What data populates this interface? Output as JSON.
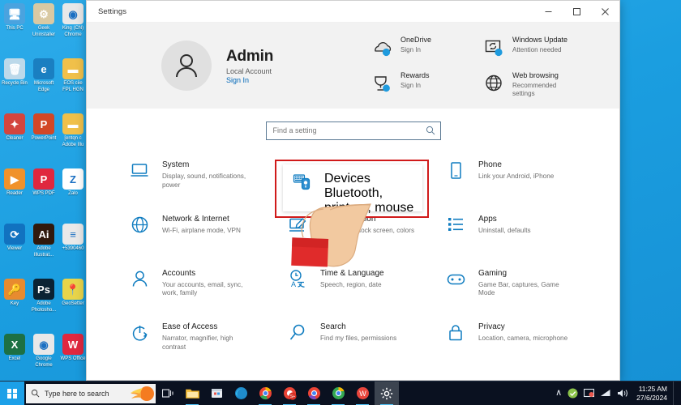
{
  "desktop": {
    "icons": [
      {
        "label": "This PC",
        "icon": "computer-icon",
        "color": "#4aa3df",
        "glyph": "🖥"
      },
      {
        "label": "Geek Uninstaller",
        "icon": "geek-uninstaller-icon",
        "color": "#d9c9a3",
        "glyph": "⚙"
      },
      {
        "label": "King (CN) Chrome",
        "icon": "chrome-king-icon",
        "color": "#e8e8e8",
        "glyph": "◉"
      },
      {
        "label": "Recycle Bin",
        "icon": "recycle-bin-icon",
        "color": "#bcd9ea",
        "glyph": "🗑"
      },
      {
        "label": "Microsoft Edge",
        "icon": "edge-icon",
        "color": "#1a7fc1",
        "glyph": "e"
      },
      {
        "label": "EOS ciie FPL HGN",
        "icon": "folder-icon",
        "color": "#f0c04a",
        "glyph": "▬"
      },
      {
        "label": "Cleaner",
        "icon": "ccleaner-icon",
        "color": "#d3453e",
        "glyph": "✦"
      },
      {
        "label": "PowerPoint",
        "icon": "powerpoint-icon",
        "color": "#d24726",
        "glyph": "P"
      },
      {
        "label": "[entqn c Adobe Illu",
        "icon": "folder-icon",
        "color": "#f0c04a",
        "glyph": "▬"
      },
      {
        "label": "Reader",
        "icon": "foxit-reader-icon",
        "color": "#f0922b",
        "glyph": "▶"
      },
      {
        "label": "WPS PDF",
        "icon": "wps-pdf-icon",
        "color": "#e0273f",
        "glyph": "P"
      },
      {
        "label": "Zalo",
        "icon": "zalo-icon",
        "color": "#ffffff",
        "glyph": "Z"
      },
      {
        "label": "Viewer",
        "icon": "teamviewer-icon",
        "color": "#1172c0",
        "glyph": "⟳"
      },
      {
        "label": "Adobe Illustrat...",
        "icon": "illustrator-icon",
        "color": "#31190c",
        "glyph": "Ai"
      },
      {
        "label": "+5390460",
        "icon": "document-icon",
        "color": "#e9e9e9",
        "glyph": "≡"
      },
      {
        "label": "Key",
        "icon": "key-icon",
        "color": "#e88b2f",
        "glyph": "🔑"
      },
      {
        "label": "Adobe Photosho...",
        "icon": "photoshop-icon",
        "color": "#0b2233",
        "glyph": "Ps"
      },
      {
        "label": "GeoSetter",
        "icon": "geosetter-icon",
        "color": "#e8d44a",
        "glyph": "📍"
      },
      {
        "label": "Excel",
        "icon": "excel-icon",
        "color": "#1d7044",
        "glyph": "X"
      },
      {
        "label": "Google Chrome",
        "icon": "chrome-icon",
        "color": "#e8e8e8",
        "glyph": "◉"
      },
      {
        "label": "WPS Office",
        "icon": "wps-office-icon",
        "color": "#e0273f",
        "glyph": "W"
      }
    ]
  },
  "taskbar": {
    "search_placeholder": "Type here to search",
    "start_name": "start-button",
    "items": [
      {
        "name": "task-view-icon",
        "glyph": "□"
      },
      {
        "name": "file-explorer-icon",
        "glyph": "📁"
      },
      {
        "name": "microsoft-store-icon",
        "glyph": "🛍"
      },
      {
        "name": "microsoft-edge-icon",
        "glyph": "e"
      },
      {
        "name": "chrome-icon",
        "glyph": "◉"
      },
      {
        "name": "chrome-profile-icon",
        "glyph": "S+"
      },
      {
        "name": "chrome-alt-icon",
        "glyph": "◉"
      },
      {
        "name": "chrome-green-icon",
        "glyph": "◉"
      },
      {
        "name": "wps-office-icon",
        "glyph": "W"
      },
      {
        "name": "settings-icon",
        "glyph": "⚙"
      }
    ],
    "tray": [
      {
        "name": "show-hidden-icons",
        "glyph": "∧"
      },
      {
        "name": "shield-icon",
        "glyph": "●"
      },
      {
        "name": "display-icon",
        "glyph": "▣"
      },
      {
        "name": "network-icon",
        "glyph": "◤"
      },
      {
        "name": "volume-icon",
        "glyph": "🔊"
      }
    ],
    "clock": {
      "time": "11:25 AM",
      "date": "27/6/2024"
    }
  },
  "window": {
    "title": "Settings",
    "controls": {
      "minimize": "–",
      "maximize": "□",
      "close": "×"
    }
  },
  "account": {
    "name": "Admin",
    "type": "Local Account",
    "signin": "Sign In",
    "avatar_name": "user-avatar"
  },
  "quicklinks": [
    {
      "icon": "onedrive-icon",
      "title": "OneDrive",
      "subtitle": "Sign In"
    },
    {
      "icon": "windows-update-icon",
      "title": "Windows Update",
      "subtitle": "Attention needed"
    },
    {
      "icon": "rewards-icon",
      "title": "Rewards",
      "subtitle": "Sign In"
    },
    {
      "icon": "web-browsing-icon",
      "title": "Web browsing",
      "subtitle": "Recommended settings"
    }
  ],
  "search": {
    "placeholder": "Find a setting",
    "value": "",
    "icon": "search-icon"
  },
  "settings_grid": [
    {
      "icon": "system-icon",
      "name": "System",
      "desc": "Display, sound, notifications, power"
    },
    {
      "icon": "devices-icon",
      "name": "Devices",
      "desc": "Bluetooth, printers, mouse"
    },
    {
      "icon": "phone-icon",
      "name": "Phone",
      "desc": "Link your Android, iPhone"
    },
    {
      "icon": "network-icon",
      "name": "Network & Internet",
      "desc": "Wi-Fi, airplane mode, VPN"
    },
    {
      "icon": "personalization-icon",
      "name": "Personalization",
      "desc": "Background, lock screen, colors"
    },
    {
      "icon": "apps-icon",
      "name": "Apps",
      "desc": "Uninstall, defaults"
    },
    {
      "icon": "accounts-icon",
      "name": "Accounts",
      "desc": "Your accounts, email, sync, work, family"
    },
    {
      "icon": "time-language-icon",
      "name": "Time & Language",
      "desc": "Speech, region, date"
    },
    {
      "icon": "gaming-icon",
      "name": "Gaming",
      "desc": "Game Bar, captures, Game Mode"
    },
    {
      "icon": "ease-of-access-icon",
      "name": "Ease of Access",
      "desc": "Narrator, magnifier, high contrast"
    },
    {
      "icon": "search-settings-icon",
      "name": "Search",
      "desc": "Find my files, permissions"
    },
    {
      "icon": "privacy-icon",
      "name": "Privacy",
      "desc": "Location, camera, microphone"
    }
  ],
  "annotation": {
    "highlight_color": "#d01a1a",
    "highlight_target": "Devices",
    "cursor": "pointing-hand"
  }
}
